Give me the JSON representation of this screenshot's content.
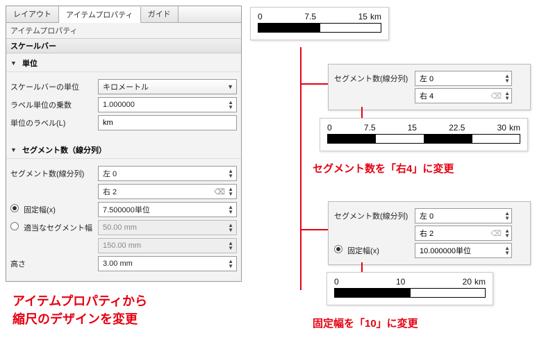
{
  "panel": {
    "tabs": {
      "layout": "レイアウト",
      "item_props": "アイテムプロパティ",
      "guide": "ガイド"
    },
    "title": "アイテムプロパティ",
    "scale_section": "スケールバー",
    "units_group": "単位",
    "units": {
      "scalebar_unit_label": "スケールバーの単位",
      "scalebar_unit_value": "キロメートル",
      "label_multiplier_label": "ラベル単位の乗数",
      "label_multiplier_value": "1.000000",
      "unit_label_label": "単位のラベル(L)",
      "unit_label_value": "km"
    },
    "segments_group": "セグメント数（線分列）",
    "segments": {
      "count_label": "セグメント数(線分列)",
      "left_value": "左 0",
      "right_value": "右 2",
      "fixed_width_label": "固定幅(x)",
      "fixed_width_value": "7.500000単位",
      "auto_width_label": "適当なセグメント幅",
      "auto_value1": "50.00 mm",
      "auto_value2": "150.00 mm",
      "height_label": "高さ",
      "height_value": "3.00 mm"
    }
  },
  "callouts": {
    "main1": "アイテムプロパティから",
    "main2": "縮尺のデザインを変更",
    "seg4": "セグメント数を「右4」に変更",
    "fixed10": "固定幅を「10」に変更"
  },
  "scalebar_top": {
    "ticks": [
      "0",
      "7.5",
      "15"
    ],
    "unit": "km",
    "pattern": [
      "black",
      "white"
    ]
  },
  "scalebar_mid": {
    "ticks": [
      "0",
      "7.5",
      "15",
      "22.5",
      "30"
    ],
    "unit": "km",
    "pattern": [
      "black",
      "white",
      "black",
      "white"
    ]
  },
  "scalebar_low": {
    "ticks": [
      "0",
      "10",
      "20"
    ],
    "unit": "km",
    "pattern": [
      "black",
      "white"
    ]
  },
  "box_seg4": {
    "label": "セグメント数(線分列)",
    "left": "左 0",
    "right": "右 4"
  },
  "box_fixed10": {
    "label": "セグメント数(線分列)",
    "left": "左 0",
    "right": "右 2",
    "fixed_label": "固定幅(x)",
    "fixed_value": "10.000000単位"
  },
  "chart_data": [
    {
      "type": "bar",
      "title": "scalebar-preview-top",
      "categories": [
        "0",
        "7.5",
        "15"
      ],
      "values": [
        1,
        1
      ],
      "unit": "km"
    },
    {
      "type": "bar",
      "title": "scalebar-preview-seg4",
      "categories": [
        "0",
        "7.5",
        "15",
        "22.5",
        "30"
      ],
      "values": [
        1,
        1,
        1,
        1
      ],
      "unit": "km"
    },
    {
      "type": "bar",
      "title": "scalebar-preview-fixed10",
      "categories": [
        "0",
        "10",
        "20"
      ],
      "values": [
        1,
        1
      ],
      "unit": "km"
    }
  ]
}
